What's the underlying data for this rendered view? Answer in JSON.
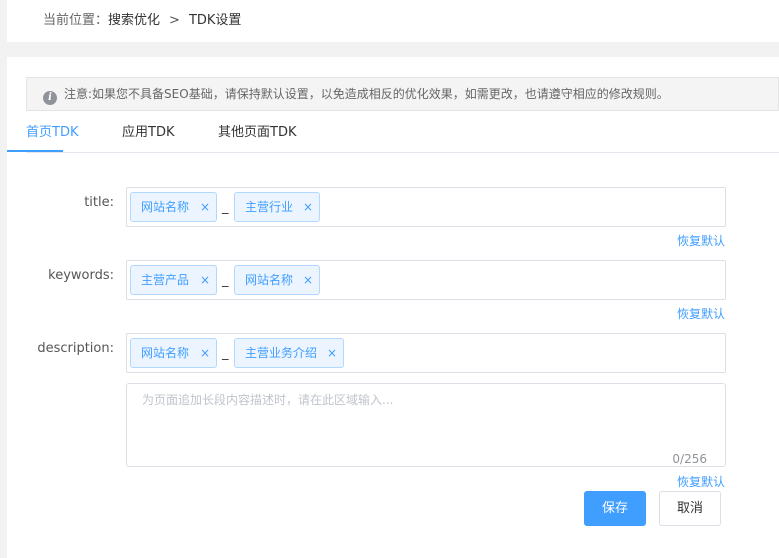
{
  "breadcrumb": {
    "prefix": "当前位置：",
    "items": [
      "搜索优化",
      "TDK设置"
    ],
    "separator": ">"
  },
  "notice": {
    "icon": "info-icon",
    "text": "注意:如果您不具备SEO基础，请保持默认设置，以免造成相反的优化效果，如需更改，也请遵守相应的修改规则。"
  },
  "tabs": [
    {
      "label": "首页TDK",
      "active": true
    },
    {
      "label": "应用TDK"
    },
    {
      "label": "其他页面TDK"
    }
  ],
  "fields": {
    "title": {
      "label": "title:",
      "tags": [
        "网站名称",
        "主营行业"
      ],
      "separator": "_",
      "restore": "恢复默认"
    },
    "keywords": {
      "label": "keywords:",
      "tags": [
        "主营产品",
        "网站名称"
      ],
      "separator": "_",
      "restore": "恢复默认"
    },
    "description": {
      "label": "description:",
      "tags": [
        "网站名称",
        "主营业务介绍"
      ],
      "separator": "_",
      "placeholder": "为页面追加长段内容描述时，请在此区域输入...",
      "counter": "0/256",
      "restore": "恢复默认"
    }
  },
  "tag_close": "×",
  "buttons": {
    "save": "保存",
    "cancel": "取消"
  },
  "colors": {
    "accent": "#409eff",
    "tag_bg": "#ecf5ff",
    "notice_bg": "#f4f4f5"
  }
}
